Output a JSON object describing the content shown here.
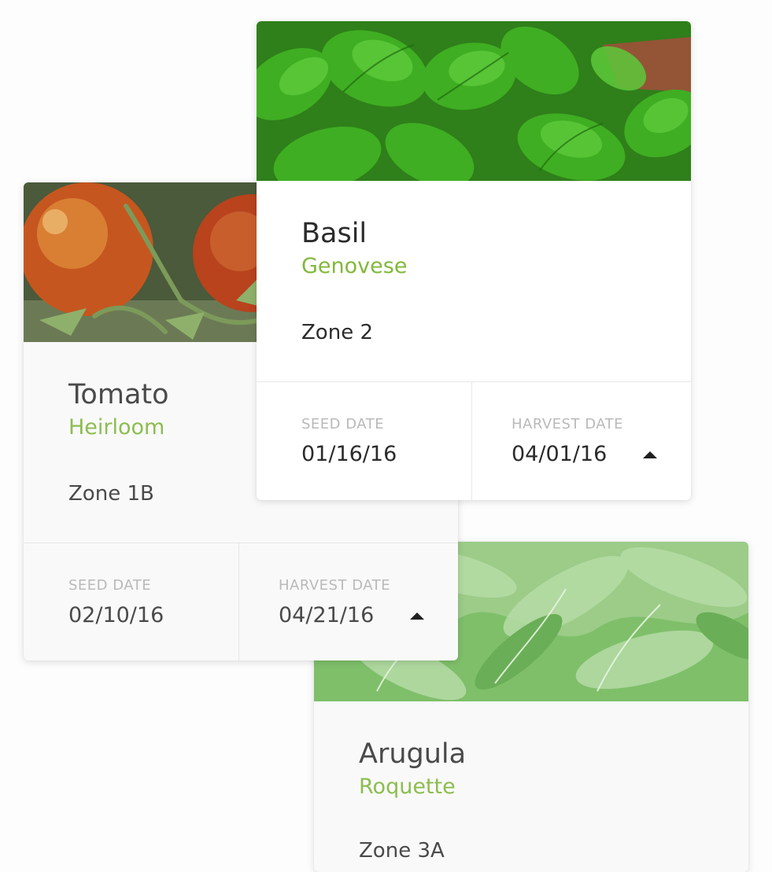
{
  "colors": {
    "variety_green": "#82b83b",
    "label_grey": "#b9b9b9",
    "text_dark": "#2b2b2b"
  },
  "cards": [
    {
      "name": "Tomato",
      "variety": "Heirloom",
      "zone": "Zone 1B",
      "seed_label": "SEED DATE",
      "seed_date": "02/10/16",
      "harvest_label": "HARVEST DATE",
      "harvest_date": "04/21/16",
      "photo": "tomato-photo",
      "sort_icon": "caret-up-icon"
    },
    {
      "name": "Basil",
      "variety": "Genovese",
      "zone": "Zone 2",
      "seed_label": "SEED DATE",
      "seed_date": "01/16/16",
      "harvest_label": "HARVEST DATE",
      "harvest_date": "04/01/16",
      "photo": "basil-photo",
      "sort_icon": "caret-up-icon"
    },
    {
      "name": "Arugula",
      "variety": "Roquette",
      "zone": "Zone 3A",
      "photo": "arugula-photo"
    }
  ]
}
